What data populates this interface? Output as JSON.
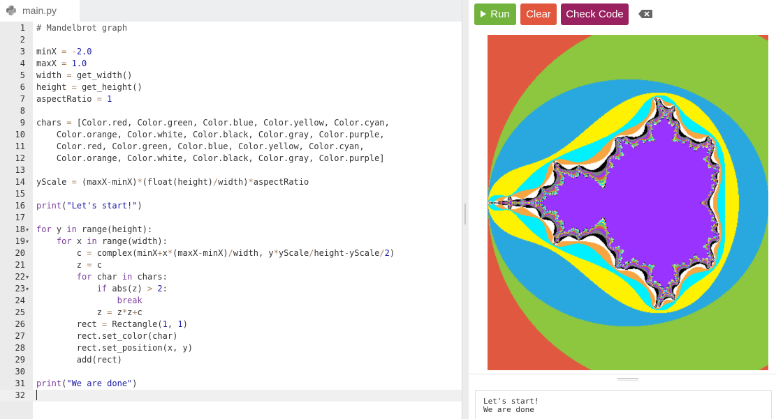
{
  "editor": {
    "tab_name": "main.py",
    "lines": [
      {
        "n": "1",
        "src": "# Mandelbrot graph",
        "cls": "cmt"
      },
      {
        "n": "2",
        "src": ""
      },
      {
        "n": "3",
        "src": "minX = -2.0"
      },
      {
        "n": "4",
        "src": "maxX = 1.0"
      },
      {
        "n": "5",
        "src": "width = get_width()"
      },
      {
        "n": "6",
        "src": "height = get_height()"
      },
      {
        "n": "7",
        "src": "aspectRatio = 1"
      },
      {
        "n": "8",
        "src": ""
      },
      {
        "n": "9",
        "src": "chars = [Color.red, Color.green, Color.blue, Color.yellow, Color.cyan,"
      },
      {
        "n": "10",
        "src": "    Color.orange, Color.white, Color.black, Color.gray, Color.purple,"
      },
      {
        "n": "11",
        "src": "    Color.red, Color.green, Color.blue, Color.yellow, Color.cyan,"
      },
      {
        "n": "12",
        "src": "    Color.orange, Color.white, Color.black, Color.gray, Color.purple]"
      },
      {
        "n": "13",
        "src": ""
      },
      {
        "n": "14",
        "src": "yScale = (maxX-minX)*(float(height)/width)*aspectRatio"
      },
      {
        "n": "15",
        "src": ""
      },
      {
        "n": "16",
        "src": "print(\"Let's start!\")"
      },
      {
        "n": "17",
        "src": ""
      },
      {
        "n": "18",
        "src": "for y in range(height):",
        "fold": true
      },
      {
        "n": "19",
        "src": "    for x in range(width):",
        "fold": true
      },
      {
        "n": "20",
        "src": "        c = complex(minX+x*(maxX-minX)/width, y*yScale/height-yScale/2)"
      },
      {
        "n": "21",
        "src": "        z = c"
      },
      {
        "n": "22",
        "src": "        for char in chars:",
        "fold": true
      },
      {
        "n": "23",
        "src": "            if abs(z) > 2:",
        "fold": true
      },
      {
        "n": "24",
        "src": "                break"
      },
      {
        "n": "25",
        "src": "            z = z*z+c"
      },
      {
        "n": "26",
        "src": "        rect = Rectangle(1, 1)"
      },
      {
        "n": "27",
        "src": "        rect.set_color(char)"
      },
      {
        "n": "28",
        "src": "        rect.set_position(x, y)"
      },
      {
        "n": "29",
        "src": "        add(rect)"
      },
      {
        "n": "30",
        "src": ""
      },
      {
        "n": "31",
        "src": "print(\"We are done\")"
      },
      {
        "n": "32",
        "src": "",
        "active": true
      }
    ]
  },
  "toolbar": {
    "run_label": "Run",
    "clear_label": "Clear",
    "check_label": "Check Code"
  },
  "console": {
    "output": [
      "Let's start!",
      "We are done"
    ]
  },
  "colors": {
    "run": "#71b33c",
    "clear": "#e0573e",
    "check": "#99215f",
    "mandel_red": "#e0583f",
    "mandel_green": "#8dc63f",
    "mandel_blue": "#29a8e0",
    "mandel_yellow": "#fff200",
    "mandel_cyan": "#00f0ff",
    "mandel_orange": "#f7a540",
    "mandel_purple": "#9933ff"
  },
  "icons": {
    "tab": "python-icon",
    "run": "play-icon",
    "clear_console": "backspace-icon"
  }
}
